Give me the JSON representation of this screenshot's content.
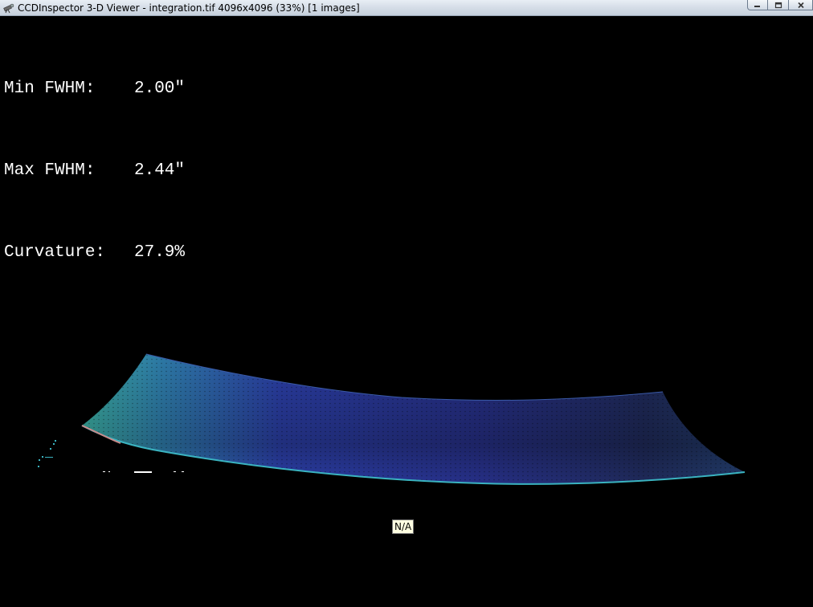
{
  "window": {
    "title": "CCDInspector 3-D Viewer - integration.tif 4096x4096 (33%)  [1 images]"
  },
  "stats": {
    "min_fwhm_label": "Min FWHM:",
    "min_fwhm_value": "2.00\"",
    "max_fwhm_label": "Max FWHM:",
    "max_fwhm_value": "2.44\"",
    "curvature_label": "Curvature:",
    "curvature_value": "27.9%"
  },
  "tooltip": {
    "text": "N/A"
  },
  "icons": {
    "app": "telescope-icon",
    "minimize": "minimize-icon",
    "maximize": "maximize-icon",
    "close": "close-icon"
  },
  "colors": {
    "background": "#000000",
    "surface_edge": "#3fb6a8",
    "surface_mid": "#2b2f9a",
    "surface_far": "#1c2440",
    "stat_text": "#ffffff",
    "tooltip_bg": "#ffffe1"
  }
}
